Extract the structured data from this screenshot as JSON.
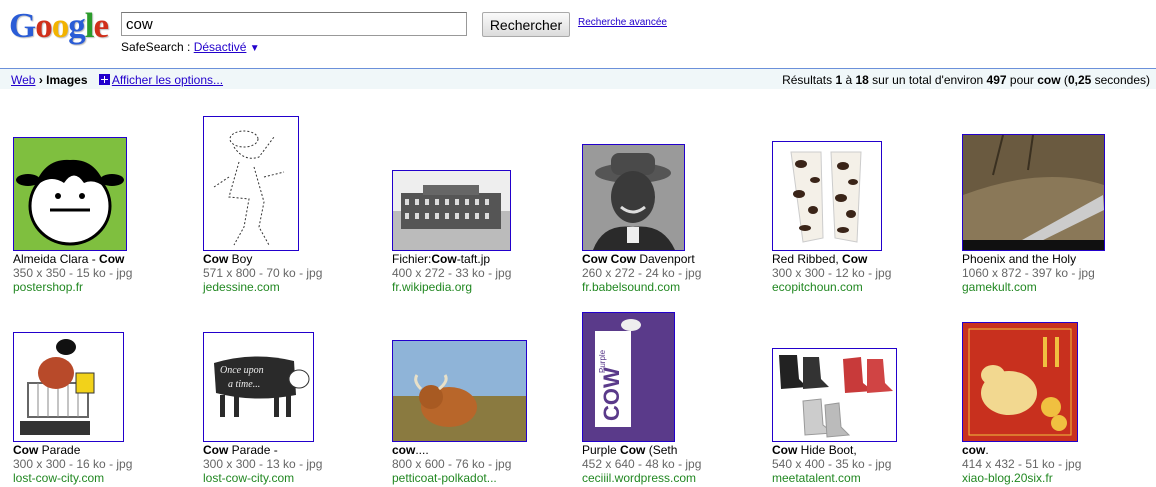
{
  "header": {
    "logo": "Google",
    "logo_colors": [
      "#2a5cd6",
      "#d0301b",
      "#f2b300",
      "#2a5cd6",
      "#2b9c2b",
      "#d0301b"
    ],
    "search_value": "cow",
    "search_button": "Rechercher",
    "advanced_link": "Recherche avancée",
    "safesearch_label": "SafeSearch :",
    "safesearch_value": "Désactivé",
    "safesearch_caret": "▼"
  },
  "bar": {
    "web": "Web",
    "sep": "›",
    "images": "Images",
    "options": "Afficher les options...",
    "results": {
      "prefix": "Résultats ",
      "from": "1",
      "a": " à ",
      "to": "18",
      "mid": " sur un total d'environ ",
      "total": "497",
      "pour": " pour ",
      "query": "cow",
      "open": " (",
      "time": "0,25",
      "close": " secondes)"
    }
  },
  "results": [
    {
      "cap_bold_first": "",
      "cap_plain": "Almeida Clara - ",
      "cap_bold": "Cow",
      "cap_tail": "",
      "meta": "350 x 350 - 15 ko - jpg",
      "site": "postershop.fr"
    },
    {
      "cap_bold_first": "Cow",
      "cap_plain": " Boy",
      "cap_bold": "",
      "cap_tail": "",
      "meta": "571 x 800 - 70 ko - jpg",
      "site": "jedessine.com"
    },
    {
      "cap_bold_first": "",
      "cap_plain": "Fichier:",
      "cap_bold": "Cow",
      "cap_tail": "-taft.jp",
      "meta": "400 x 272 - 33 ko - jpg",
      "site": "fr.wikipedia.org"
    },
    {
      "cap_bold_first": "Cow Cow",
      "cap_plain": " Davenport",
      "cap_bold": "",
      "cap_tail": "",
      "meta": "260 x 272 - 24 ko - jpg",
      "site": "fr.babelsound.com"
    },
    {
      "cap_bold_first": "",
      "cap_plain": "Red Ribbed, ",
      "cap_bold": "Cow",
      "cap_tail": "",
      "meta": "300 x 300 - 12 ko - jpg",
      "site": "ecopitchoun.com"
    },
    {
      "cap_bold_first": "",
      "cap_plain": "Phoenix and the Holy",
      "cap_bold": "",
      "cap_tail": "",
      "meta": "1060 x 872 - 397 ko - jpg",
      "site": "gamekult.com"
    },
    {
      "cap_bold_first": "Cow",
      "cap_plain": " Parade",
      "cap_bold": "",
      "cap_tail": "",
      "meta": "300 x 300 - 16 ko - jpg",
      "site": "lost-cow-city.com"
    },
    {
      "cap_bold_first": "Cow",
      "cap_plain": " Parade -",
      "cap_bold": "",
      "cap_tail": "",
      "meta": "300 x 300 - 13 ko - jpg",
      "site": "lost-cow-city.com"
    },
    {
      "cap_bold_first": "cow",
      "cap_plain": "....",
      "cap_bold": "",
      "cap_tail": "",
      "meta": "800 x 600 - 76 ko - jpg",
      "site": "petticoat-polkadot..."
    },
    {
      "cap_bold_first": "",
      "cap_plain": "Purple ",
      "cap_bold": "Cow",
      "cap_tail": " (Seth",
      "meta": "452 x 640 - 48 ko - jpg",
      "site": "ceciiil.wordpress.com"
    },
    {
      "cap_bold_first": "Cow",
      "cap_plain": " Hide Boot,",
      "cap_bold": "",
      "cap_tail": "",
      "meta": "540 x 400 - 35 ko - jpg",
      "site": "meetatalent.com"
    },
    {
      "cap_bold_first": "cow",
      "cap_plain": ".",
      "cap_bold": "",
      "cap_tail": "",
      "meta": "414 x 432 - 51 ko - jpg",
      "site": "xiao-blog.20six.fr"
    }
  ],
  "thumb_text": {
    "purple_cow": "Purple COW",
    "once": "Once upon a time..."
  }
}
